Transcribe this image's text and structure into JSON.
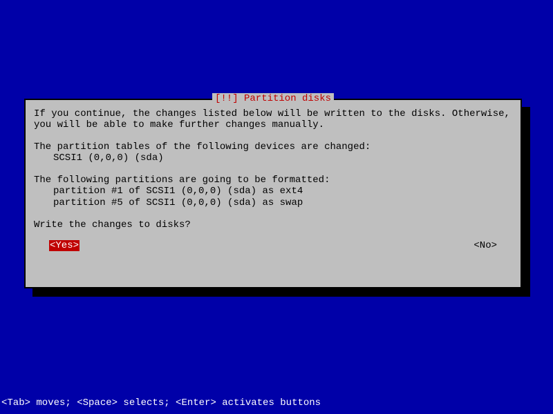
{
  "dialog": {
    "title": "[!!] Partition disks",
    "intro": "If you continue, the changes listed below will be written to the disks. Otherwise, you will be able to make further changes manually.",
    "tables_heading": "The partition tables of the following devices are changed:",
    "tables_list": [
      "SCSI1 (0,0,0) (sda)"
    ],
    "format_heading": "The following partitions are going to be formatted:",
    "format_list": [
      "partition #1 of SCSI1 (0,0,0) (sda) as ext4",
      "partition #5 of SCSI1 (0,0,0) (sda) as swap"
    ],
    "prompt": "Write the changes to disks?",
    "buttons": {
      "yes": "<Yes>",
      "no": "<No>"
    }
  },
  "footer": "<Tab> moves; <Space> selects; <Enter> activates buttons"
}
